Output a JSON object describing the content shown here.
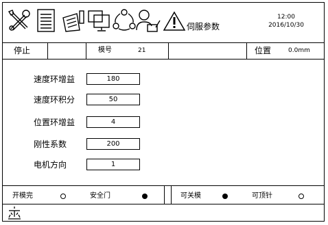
{
  "header": {
    "icons": [
      "tools-icon",
      "document-icon",
      "edit-document-icon",
      "monitor-icon",
      "cycle-icon",
      "user-edit-icon",
      "warning-icon"
    ],
    "title": "伺服参数",
    "time": "12:00",
    "date": "2016/10/30"
  },
  "info_bar": {
    "status": "停止",
    "mold_label": "模号",
    "mold_value": "21",
    "position_label": "位置",
    "position_value": "0.0mm"
  },
  "params": [
    {
      "label": "速度环增益",
      "value": "180"
    },
    {
      "label": "速度环积分",
      "value": "50"
    },
    {
      "label": "位置环增益",
      "value": "4"
    },
    {
      "label": "刚性系数",
      "value": "200"
    },
    {
      "label": "电机方向",
      "value": "1"
    }
  ],
  "status_bar": [
    {
      "label": "开模完",
      "state": "off"
    },
    {
      "label": "安全门",
      "state": "on"
    },
    {
      "label": "可关模",
      "state": "on"
    },
    {
      "label": "可顶针",
      "state": "off"
    }
  ],
  "footer": {
    "icon": "home-icon"
  }
}
